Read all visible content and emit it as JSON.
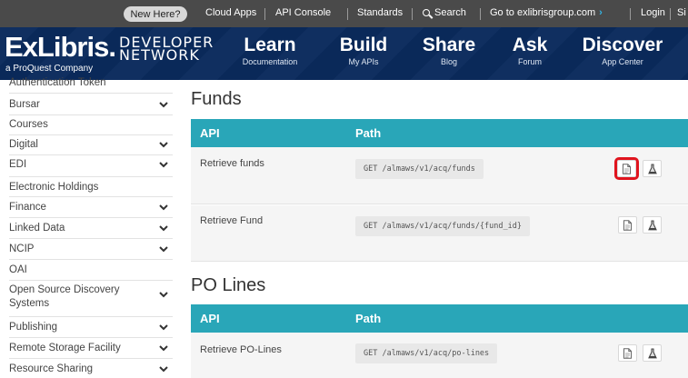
{
  "topbar": {
    "new_here": "New Here?",
    "links": [
      "Cloud Apps",
      "API Console",
      "Standards",
      "Search",
      "Go to exlibrisgroup.com",
      "Login",
      "Si"
    ]
  },
  "nav": {
    "logo": "ExLibris.",
    "logo_tagline": "a ProQuest Company",
    "developer": "DEVELOPER",
    "network": "NETWORK",
    "items": [
      {
        "title": "Learn",
        "sub": "Documentation"
      },
      {
        "title": "Build",
        "sub": "My APIs"
      },
      {
        "title": "Share",
        "sub": "Blog"
      },
      {
        "title": "Ask",
        "sub": "Forum"
      },
      {
        "title": "Discover",
        "sub": "App Center"
      }
    ]
  },
  "sidebar": {
    "items": [
      {
        "label": "Authentication Token",
        "expandable": false
      },
      {
        "label": "Bursar",
        "expandable": true
      },
      {
        "label": "Courses",
        "expandable": false
      },
      {
        "label": "Digital",
        "expandable": true
      },
      {
        "label": "EDI",
        "expandable": true
      },
      {
        "label": "Electronic Holdings",
        "expandable": false
      },
      {
        "label": "Finance",
        "expandable": true
      },
      {
        "label": "Linked Data",
        "expandable": true
      },
      {
        "label": "NCIP",
        "expandable": true
      },
      {
        "label": "OAI",
        "expandable": false
      },
      {
        "label": "Open Source Discovery Systems",
        "expandable": true
      },
      {
        "label": "Publishing",
        "expandable": true
      },
      {
        "label": "Remote Storage Facility",
        "expandable": true
      },
      {
        "label": "Resource Sharing",
        "expandable": true
      }
    ]
  },
  "sections": [
    {
      "title": "Funds",
      "col_api": "API",
      "col_path": "Path",
      "rows": [
        {
          "name": "Retrieve funds",
          "path": "GET /almaws/v1/acq/funds"
        },
        {
          "name": "Retrieve Fund",
          "path": "GET /almaws/v1/acq/funds/{fund_id}"
        }
      ]
    },
    {
      "title": "PO Lines",
      "col_api": "API",
      "col_path": "Path",
      "rows": [
        {
          "name": "Retrieve PO-Lines",
          "path": "GET /almaws/v1/acq/po-lines"
        }
      ]
    }
  ],
  "colors": {
    "topbar": "#4a4a4a",
    "nav": "#0a2a5c",
    "table_header": "#29a6b8",
    "highlight": "#e0141e",
    "row_bg": "#f5f5f5"
  },
  "icons": [
    "search-icon",
    "chevron-right-icon",
    "chevron-down-icon",
    "document-icon",
    "test-flask-icon"
  ]
}
